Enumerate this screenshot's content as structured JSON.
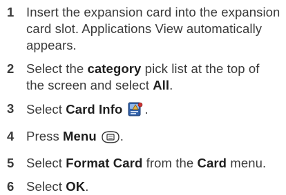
{
  "steps": [
    {
      "number": "1",
      "text": "Insert the expansion card into the expansion card slot. Applications View automatically appears."
    },
    {
      "number": "2",
      "pre": "Select the ",
      "bold1": "category",
      "mid": " pick list at the top of the screen and select ",
      "bold2": "All",
      "post": "."
    },
    {
      "number": "3",
      "pre": "Select ",
      "bold1": "Card Info",
      "icon": "card-info-app-icon"
    },
    {
      "number": "4",
      "pre": "Press ",
      "bold1": "Menu",
      "icon": "menu-button-icon"
    },
    {
      "number": "5",
      "pre": "Select ",
      "bold1": "Format Card",
      "mid": " from the ",
      "bold2": "Card",
      "post": " menu."
    },
    {
      "number": "6",
      "pre": "Select ",
      "bold1": "OK",
      "post": "."
    }
  ],
  "colors": {
    "text": "#3a3a3a",
    "bold": "#1f1f1f"
  }
}
